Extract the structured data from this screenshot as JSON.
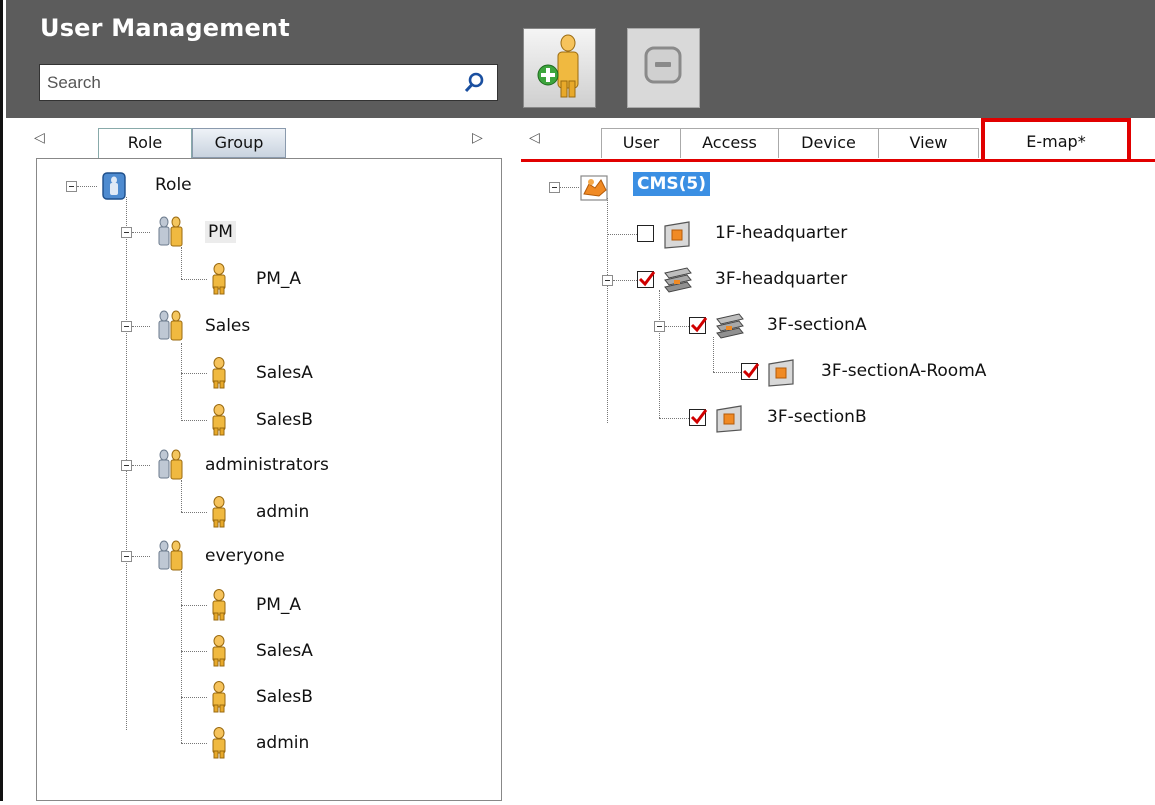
{
  "app": {
    "title": "User Management"
  },
  "search": {
    "placeholder": "Search",
    "value": ""
  },
  "colors": {
    "header_bg": "#5c5c5c",
    "highlight": "#3b8fe3",
    "annotation": "#e10000"
  },
  "left_tabs": [
    {
      "label": "Role",
      "active": true
    },
    {
      "label": "Group",
      "active": false
    }
  ],
  "right_tabs": [
    {
      "label": "User",
      "active": false
    },
    {
      "label": "Access",
      "active": false
    },
    {
      "label": "Device",
      "active": false
    },
    {
      "label": "View",
      "active": false
    },
    {
      "label": "E-map*",
      "active": true
    }
  ],
  "role_tree": {
    "root": "Role",
    "groups": [
      {
        "label": "PM",
        "members": [
          "PM_A"
        ]
      },
      {
        "label": "Sales",
        "members": [
          "SalesA",
          "SalesB"
        ]
      },
      {
        "label": "administrators",
        "members": [
          "admin"
        ]
      },
      {
        "label": "everyone",
        "members": [
          "PM_A",
          "SalesA",
          "SalesB",
          "admin"
        ]
      }
    ]
  },
  "emap_tree": {
    "root": "CMS(5)",
    "items": [
      {
        "label": "1F-headquarter",
        "checked": false
      },
      {
        "label": "3F-headquarter",
        "checked": true
      },
      {
        "label": "3F-sectionA",
        "checked": true
      },
      {
        "label": "3F-sectionA-RoomA",
        "checked": true
      },
      {
        "label": "3F-sectionB",
        "checked": true
      }
    ]
  }
}
